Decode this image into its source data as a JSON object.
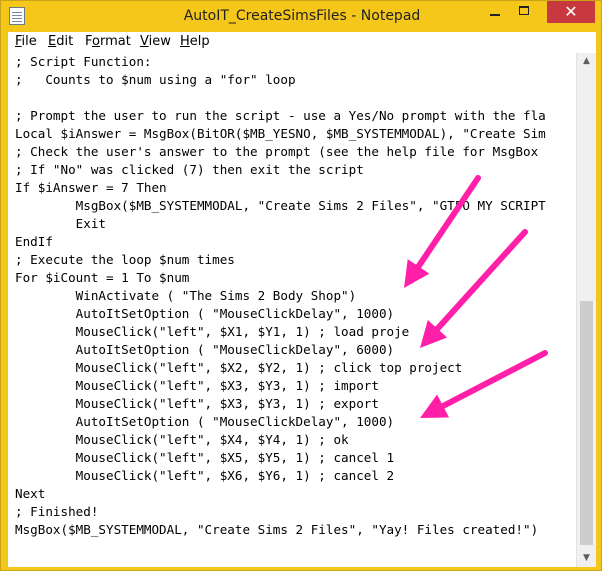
{
  "window": {
    "title": "AutoIT_CreateSimsFiles - Notepad",
    "controls": {
      "minimize": "–",
      "maximize": "□",
      "close": "✕"
    }
  },
  "menu": {
    "items": [
      {
        "label": "File",
        "accel": "F",
        "rest": "ile"
      },
      {
        "label": "Edit",
        "accel": "E",
        "rest": "dit"
      },
      {
        "label": "Format",
        "accel": "o",
        "pre": "F",
        "rest": "rmat"
      },
      {
        "label": "View",
        "accel": "V",
        "rest": "iew"
      },
      {
        "label": "Help",
        "accel": "H",
        "rest": "elp"
      }
    ]
  },
  "editor": {
    "lines": [
      "; Script Function:",
      ";   Counts to $num using a \"for\" loop",
      "",
      "; Prompt the user to run the script - use a Yes/No prompt with the fla",
      "Local $iAnswer = MsgBox(BitOR($MB_YESNO, $MB_SYSTEMMODAL), \"Create Sim",
      "; Check the user's answer to the prompt (see the help file for MsgBox",
      "; If \"No\" was clicked (7) then exit the script",
      "If $iAnswer = 7 Then",
      "        MsgBox($MB_SYSTEMMODAL, \"Create Sims 2 Files\", \"GTFO MY SCRIPT",
      "        Exit",
      "EndIf",
      "; Execute the loop $num times",
      "For $iCount = 1 To $num",
      "        WinActivate ( \"The Sims 2 Body Shop\")",
      "        AutoItSetOption ( \"MouseClickDelay\", 1000)",
      "        MouseClick(\"left\", $X1, $Y1, 1) ; load proje",
      "        AutoItSetOption ( \"MouseClickDelay\", 6000)",
      "        MouseClick(\"left\", $X2, $Y2, 1) ; click top project",
      "        MouseClick(\"left\", $X3, $Y3, 1) ; import",
      "        MouseClick(\"left\", $X3, $Y3, 1) ; export",
      "        AutoItSetOption ( \"MouseClickDelay\", 1000)",
      "        MouseClick(\"left\", $X4, $Y4, 1) ; ok",
      "        MouseClick(\"left\", $X5, $Y5, 1) ; cancel 1",
      "        MouseClick(\"left\", $X6, $Y6, 1) ; cancel 2",
      "Next",
      "; Finished!",
      "MsgBox($MB_SYSTEMMODAL, \"Create Sims 2 Files\", \"Yay! Files created!\")"
    ]
  },
  "scrollbar": {
    "up_icon": "▲",
    "down_icon": "▼"
  },
  "annotations": {
    "arrow_color": "#ff1fa8"
  }
}
